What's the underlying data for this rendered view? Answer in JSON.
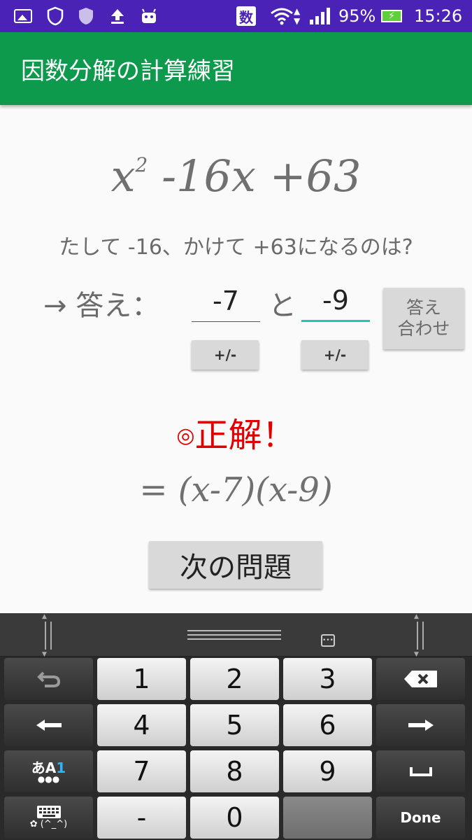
{
  "status_bar": {
    "kanji_badge": "数",
    "battery_text": "95%",
    "time": "15:26"
  },
  "app_bar": {
    "title": "因数分解の計算練習"
  },
  "problem": {
    "base": "x",
    "exponent": "2",
    "rest": " -16x +63"
  },
  "hint": "たして -16、かけて +63になるのは?",
  "answer": {
    "label": "→ 答え：",
    "first_value": "-7",
    "connector": "と",
    "second_value": "-9",
    "sign_toggle_label": "+/-",
    "check_label_line1": "答え",
    "check_label_line2": "合わせ"
  },
  "result": {
    "mark": "◎",
    "text": "正解！",
    "factored": "= (x-7)(x-9)"
  },
  "next_button": "次の問題",
  "keyboard": {
    "keys": {
      "k1": "1",
      "k2": "2",
      "k3": "3",
      "k4": "4",
      "k5": "5",
      "k6": "6",
      "k7": "7",
      "k8": "8",
      "k9": "9",
      "k0": "0",
      "minus": "-",
      "mode_a": "あA",
      "mode_one": "1",
      "emoticon": "(^_^)",
      "done": "Done"
    },
    "icons": {
      "undo": "undo-icon",
      "backspace": "backspace-icon",
      "left": "arrow-left-icon",
      "right": "arrow-right-icon",
      "space": "space-icon",
      "keyboard": "keyboard-icon"
    }
  }
}
